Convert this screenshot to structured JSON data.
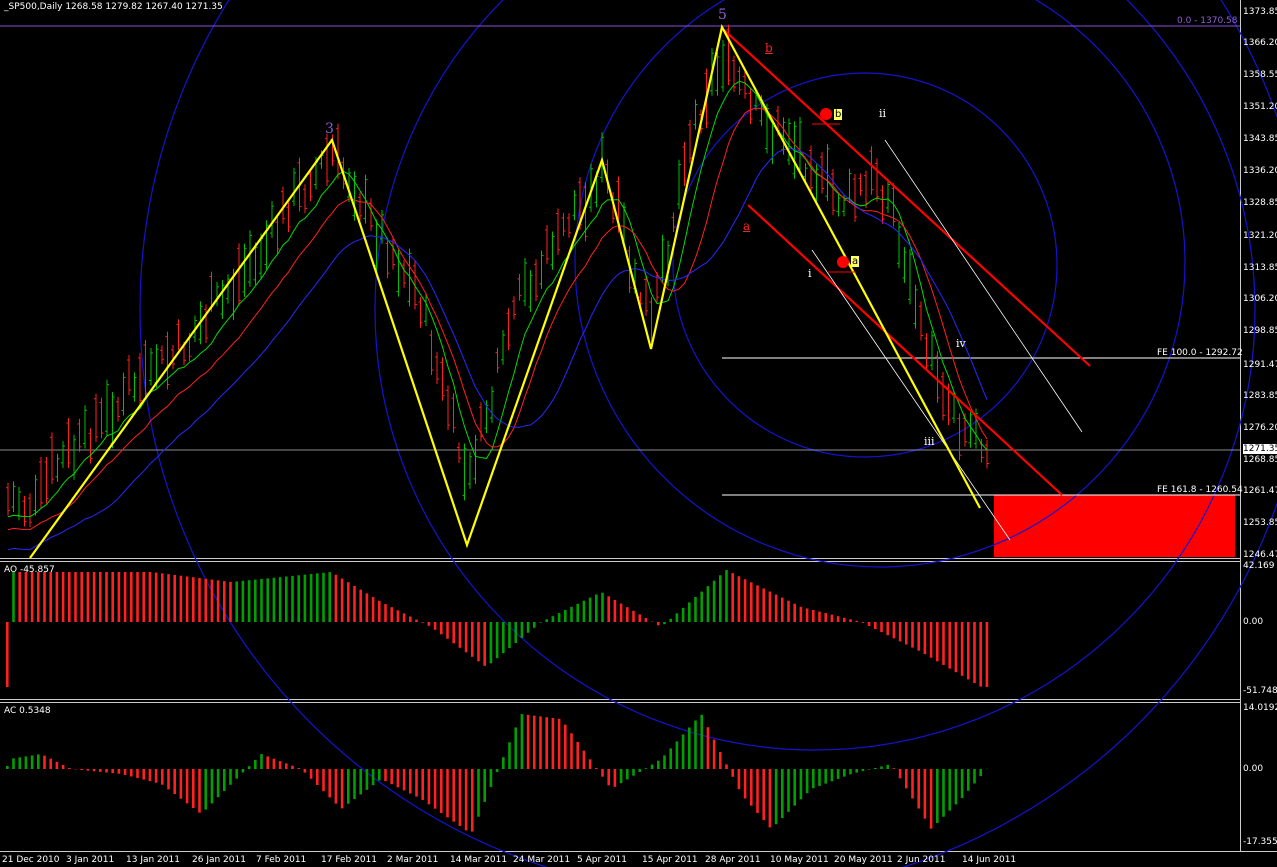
{
  "header": {
    "main": "_SP500,Daily  1268.58 1279.82 1267.40 1271.35",
    "ao": "AO -45.857",
    "ac": "AC 0.5348"
  },
  "colors": {
    "background": "#000000",
    "bull_bar": "#00c000",
    "bear_bar": "#ff2020",
    "zigzag": "#ffff00",
    "channel": "#ff0000",
    "circles": "#1010d0",
    "fib_text": "#9060d0",
    "ma_fast": "#00dd00",
    "ma_mid": "#ff2020",
    "ma_slow": "#2020ff"
  },
  "price_axis": {
    "ticks": [
      "1373.85",
      "1366.20",
      "1358.55",
      "1351.20",
      "1343.85",
      "1336.20",
      "1328.85",
      "1321.20",
      "1313.85",
      "1306.20",
      "1298.85",
      "1291.47",
      "1283.85",
      "1276.20",
      "1271.35",
      "1268.85",
      "1261.47",
      "1253.85",
      "1246.47"
    ],
    "current": "1271.35"
  },
  "ao_axis": {
    "ticks": [
      "42.169",
      "0.00",
      "-51.748"
    ]
  },
  "ac_axis": {
    "ticks": [
      "14.0192",
      "0.00",
      "-17.3555"
    ]
  },
  "date_axis": [
    "21 Dec 2010",
    "3 Jan 2011",
    "13 Jan 2011",
    "26 Jan 2011",
    "7 Feb 2011",
    "17 Feb 2011",
    "2 Mar 2011",
    "14 Mar 2011",
    "24 Mar 2011",
    "5 Apr 2011",
    "15 Apr 2011",
    "28 Apr 2011",
    "10 May 2011",
    "20 May 2011",
    "2 Jun 2011",
    "14 Jun 2011"
  ],
  "fib_levels": {
    "top": "0.0 - 1370.58",
    "fe100": "FE 100.0 - 1292.72",
    "fe161": "FE 161.8 - 1260.54"
  },
  "wave_labels": {
    "w3": "3",
    "w5": "5",
    "a_upper": "a",
    "b_upper": "b",
    "i": "i",
    "ii": "ii",
    "iii": "iii",
    "iv": "iv",
    "a_tag": "a",
    "b_tag": "b"
  },
  "chart_data": {
    "type": "ohlc",
    "title": "_SP500,Daily",
    "ylim": [
      1246.47,
      1373.85
    ],
    "zigzag": [
      {
        "date": "2010-12-21",
        "price": 1246
      },
      {
        "date": "2011-02-18",
        "price": 1344
      },
      {
        "date": "2011-03-16",
        "price": 1250
      },
      {
        "date": "2011-04-05",
        "price": 1339
      },
      {
        "date": "2011-04-18",
        "price": 1294
      },
      {
        "date": "2011-04-29",
        "price": 1370
      },
      {
        "date": "2011-06-16",
        "price": 1258
      }
    ],
    "fe_levels": [
      1292.72,
      1260.54
    ],
    "target_zone": [
      1246.47,
      1260.54
    ],
    "ao_last": -45.857,
    "ac_last": 0.5348
  }
}
